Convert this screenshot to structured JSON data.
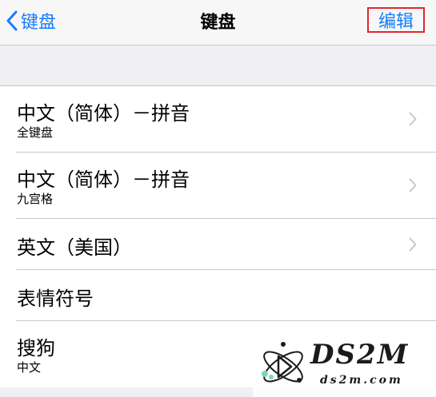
{
  "navbar": {
    "back_label": "键盘",
    "title": "键盘",
    "edit_label": "编辑",
    "accent_color": "#157efb",
    "highlight_color": "#e0272e"
  },
  "keyboards": [
    {
      "title": "中文（简体）－拼音",
      "subtitle": "全键盘",
      "has_chevron": true
    },
    {
      "title": "中文（简体）－拼音",
      "subtitle": "九宫格",
      "has_chevron": true
    },
    {
      "title": "英文（美国）",
      "subtitle": "",
      "has_chevron": true
    },
    {
      "title": "表情符号",
      "subtitle": "",
      "has_chevron": false
    },
    {
      "title": "搜狗",
      "subtitle": "中文",
      "has_chevron": false
    }
  ],
  "watermark": {
    "name": "DS2M",
    "url": "ds2m.com"
  },
  "icons": {
    "back": "chevron-left-icon",
    "disclosure": "chevron-right-icon"
  }
}
